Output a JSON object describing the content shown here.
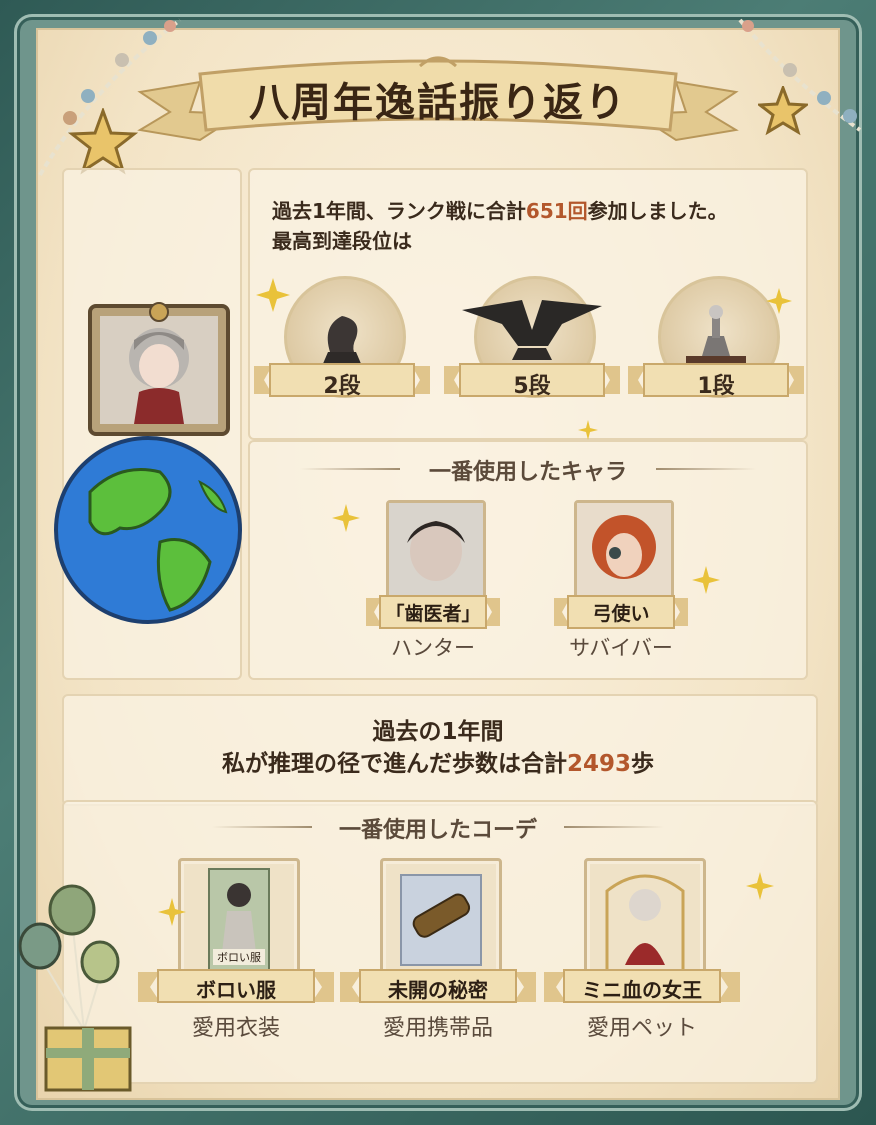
{
  "title": "八周年逸話振り返り",
  "rank": {
    "text_prefix": "過去1年間、ランク戦に合計",
    "count": "651回",
    "text_suffix": "参加しました。",
    "line2": "最高到達段位は",
    "medals": [
      {
        "label": "2段",
        "icon": "chess-knight-trophy-icon"
      },
      {
        "label": "5段",
        "icon": "dragon-trophy-icon"
      },
      {
        "label": "1段",
        "icon": "chess-pawn-trophy-icon"
      }
    ]
  },
  "characters": {
    "heading": "一番使用したキャラ",
    "items": [
      {
        "name": "「歯医者」",
        "role": "ハンター"
      },
      {
        "name": "弓使い",
        "role": "サバイバー"
      }
    ]
  },
  "walk": {
    "line1": "過去の1年間",
    "line2_prefix": "私が推理の径で進んだ歩数は合計",
    "steps": "2493",
    "line2_suffix": "歩"
  },
  "outfit": {
    "heading": "一番使用したコーデ",
    "items": [
      {
        "name": "ボロい服",
        "role": "愛用衣装",
        "tag": "ボロい服"
      },
      {
        "name": "未開の秘密",
        "role": "愛用携帯品"
      },
      {
        "name": "ミニ血の女王",
        "role": "愛用ペット"
      }
    ]
  },
  "colors": {
    "frame": "#3d6b64",
    "paper": "#f3e4c6",
    "highlight": "#b3572c"
  }
}
